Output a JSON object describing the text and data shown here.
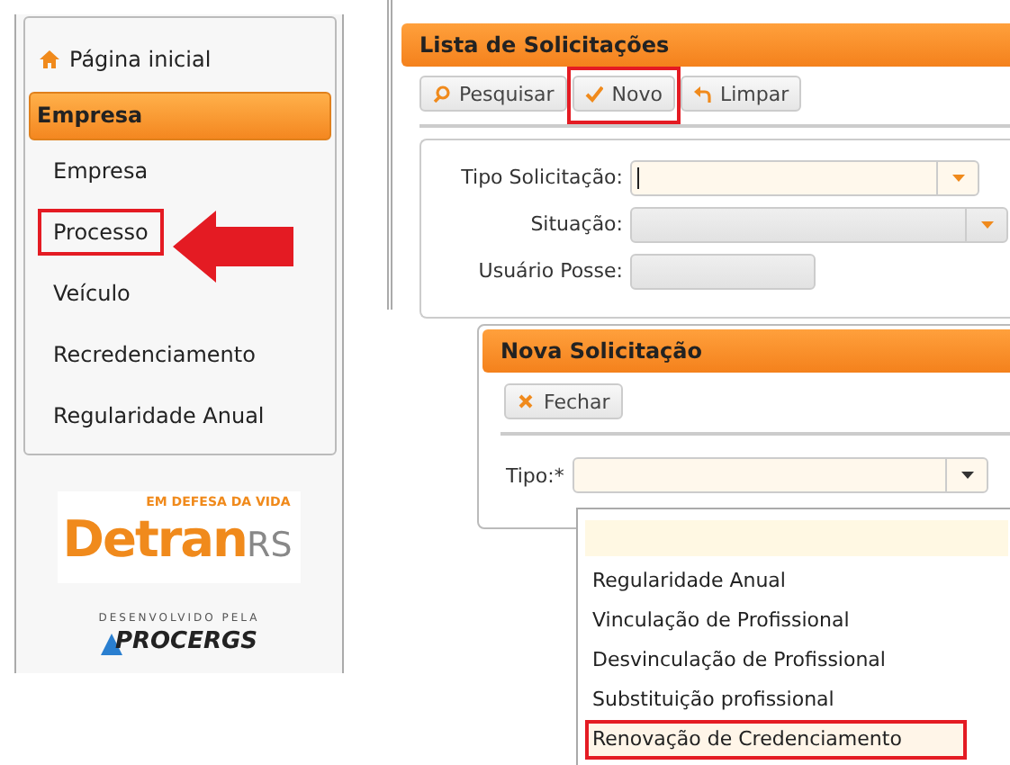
{
  "sidebar": {
    "home": "Página inicial",
    "section": "Empresa",
    "items": [
      {
        "label": "Empresa",
        "highlighted": false
      },
      {
        "label": "Processo",
        "highlighted": true
      },
      {
        "label": "Veículo",
        "highlighted": false
      },
      {
        "label": "Recredenciamento",
        "highlighted": false
      },
      {
        "label": "Regularidade Anual",
        "highlighted": false
      }
    ],
    "logo": {
      "tagline": "EM DEFESA DA VIDA",
      "name": "Detran",
      "suffix": "RS"
    },
    "credit": {
      "caption": "DESENVOLVIDO PELA",
      "name": "PROCERGS"
    }
  },
  "list_panel": {
    "title": "Lista de Solicitações",
    "buttons": [
      {
        "label": "Pesquisar",
        "highlighted": false
      },
      {
        "label": "Novo",
        "highlighted": true
      },
      {
        "label": "Limpar",
        "highlighted": false
      }
    ],
    "fields": [
      {
        "label": "Tipo Solicitação:",
        "kind": "combo",
        "focused": true
      },
      {
        "label": "Situação:",
        "kind": "combo",
        "focused": false
      },
      {
        "label": "Usuário Posse:",
        "kind": "text",
        "focused": false
      }
    ]
  },
  "new_panel": {
    "title": "Nova Solicitação",
    "buttons": [
      {
        "label": "Fechar"
      }
    ],
    "field": {
      "label": "Tipo:*"
    },
    "options": [
      {
        "label": "Regularidade Anual",
        "highlighted": false
      },
      {
        "label": "Vinculação de Profissional",
        "highlighted": false
      },
      {
        "label": "Desvinculação de Profissional",
        "highlighted": false
      },
      {
        "label": "Substituição profissional",
        "highlighted": false
      },
      {
        "label": "Renovação de Credenciamento",
        "highlighted": true
      }
    ]
  }
}
